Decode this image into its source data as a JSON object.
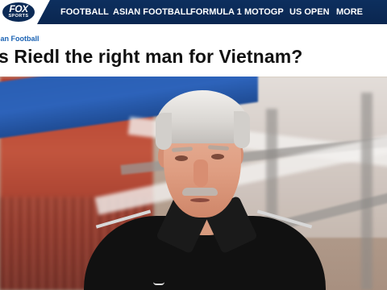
{
  "brand": {
    "logo_top": "FOX",
    "logo_bottom": "SPORTS",
    "navy": "#0b2a56",
    "link_blue": "#1b63b4"
  },
  "nav": {
    "items": [
      {
        "label": "FOOTBALL"
      },
      {
        "label": "ASIAN FOOTBALL"
      },
      {
        "label": "FORMULA 1"
      },
      {
        "label": "MOTOGP"
      },
      {
        "label": "US OPEN"
      },
      {
        "label": "MORE"
      }
    ]
  },
  "article": {
    "section": "ian Football",
    "headline": "s Riedl the right man for Vietnam?"
  },
  "hero": {
    "icon": "hero-photo"
  }
}
